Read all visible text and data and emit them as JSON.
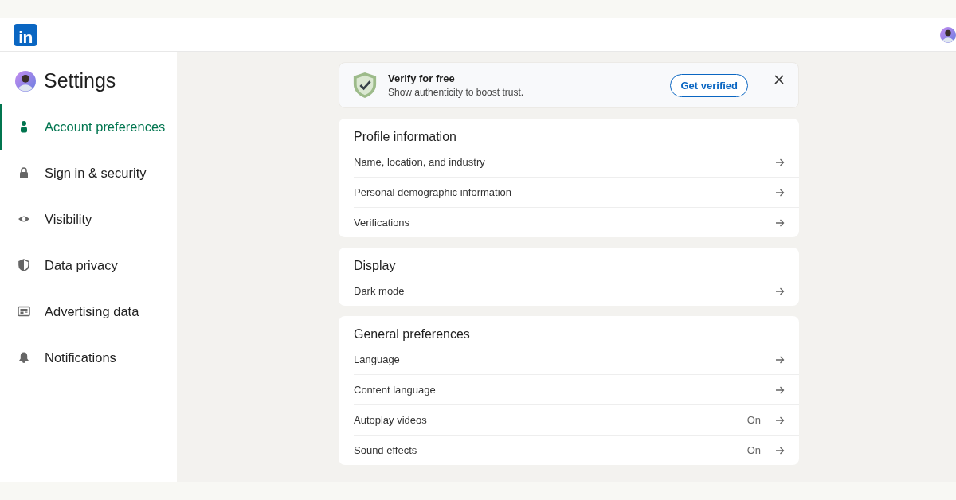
{
  "header": {
    "logo": "in"
  },
  "sidebar": {
    "title": "Settings",
    "items": [
      {
        "label": "Account preferences",
        "selected": true
      },
      {
        "label": "Sign in & security",
        "selected": false
      },
      {
        "label": "Visibility",
        "selected": false
      },
      {
        "label": "Data privacy",
        "selected": false
      },
      {
        "label": "Advertising data",
        "selected": false
      },
      {
        "label": "Notifications",
        "selected": false
      }
    ]
  },
  "banner": {
    "title": "Verify for free",
    "subtitle": "Show authenticity to boost trust.",
    "button": "Get verified"
  },
  "sections": [
    {
      "title": "Profile information",
      "rows": [
        {
          "label": "Name, location, and industry"
        },
        {
          "label": "Personal demographic information"
        },
        {
          "label": "Verifications"
        }
      ]
    },
    {
      "title": "Display",
      "rows": [
        {
          "label": "Dark mode"
        }
      ]
    },
    {
      "title": "General preferences",
      "rows": [
        {
          "label": "Language"
        },
        {
          "label": "Content language"
        },
        {
          "label": "Autoplay videos",
          "value": "On"
        },
        {
          "label": "Sound effects",
          "value": "On"
        }
      ]
    }
  ]
}
